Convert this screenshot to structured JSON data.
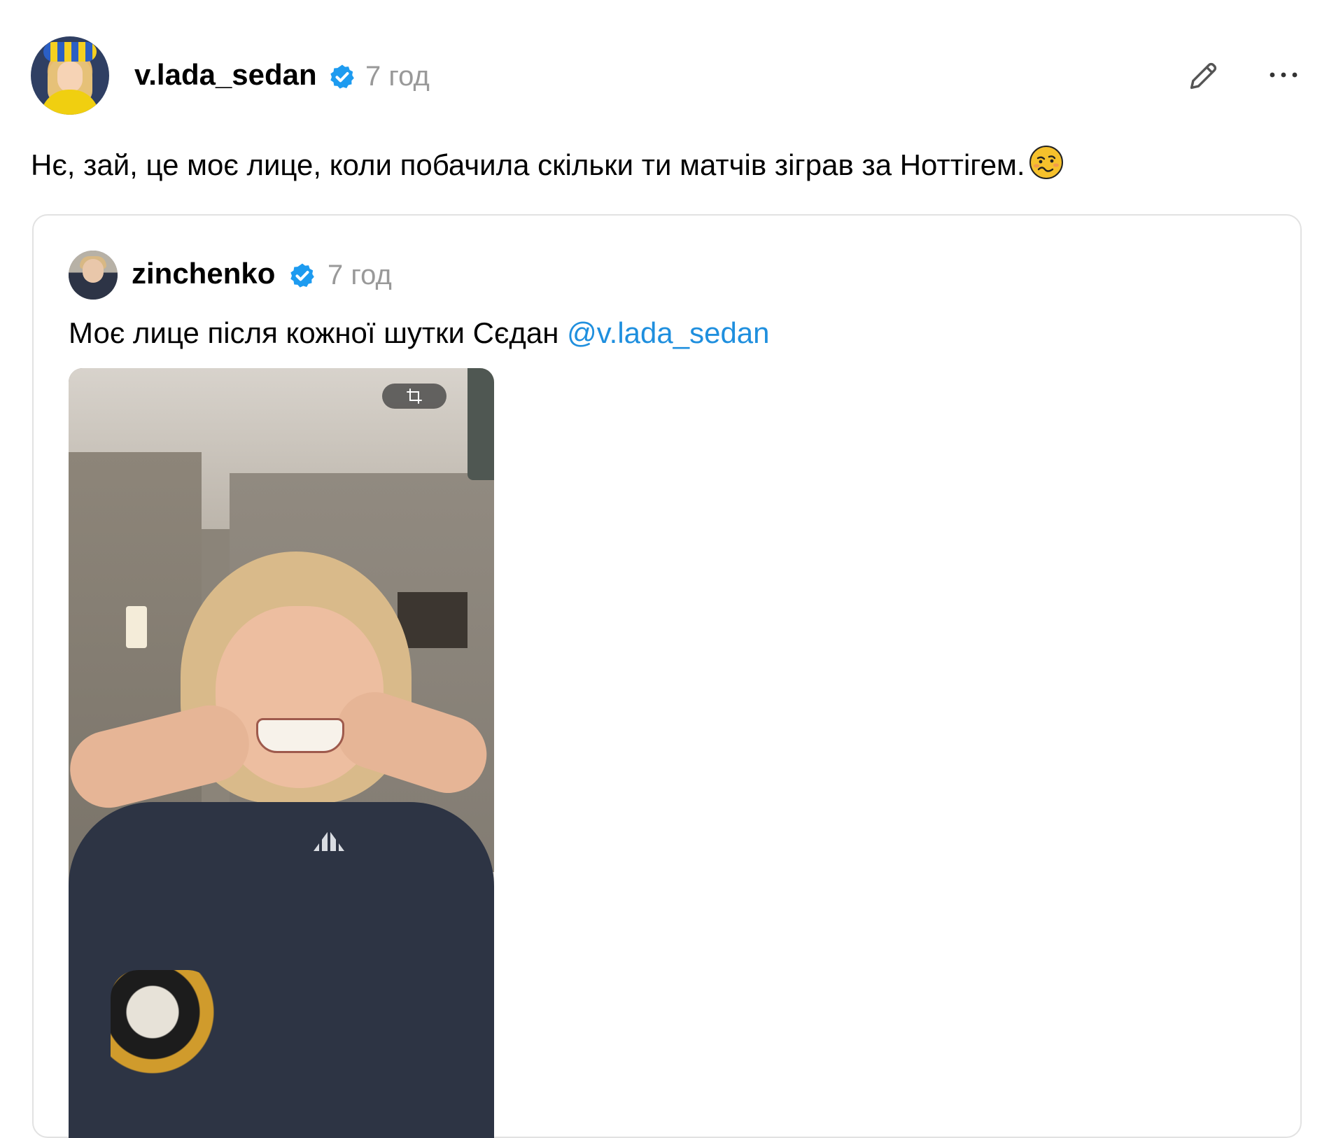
{
  "post": {
    "username": "v.lada_sedan",
    "time": "7 год",
    "text": "Нє, зай, це моє лице, коли побачила скільки ти матчів зіграв за Ноттігем."
  },
  "quoted": {
    "username": "zinchenko",
    "time": "7 год",
    "text": "Моє лице після кожної шутки Сєдан ",
    "mention": "@v.lada_sedan"
  },
  "icons": {
    "verified": "verified-badge-icon",
    "edit": "pencil-icon",
    "more": "more-dots-icon",
    "emoji": "woozy-face-emoji",
    "crop": "crop-icon"
  },
  "colors": {
    "verified": "#1d9bf0",
    "mention": "#1f8fde",
    "muted": "#999999",
    "border": "#e2e2e2"
  }
}
